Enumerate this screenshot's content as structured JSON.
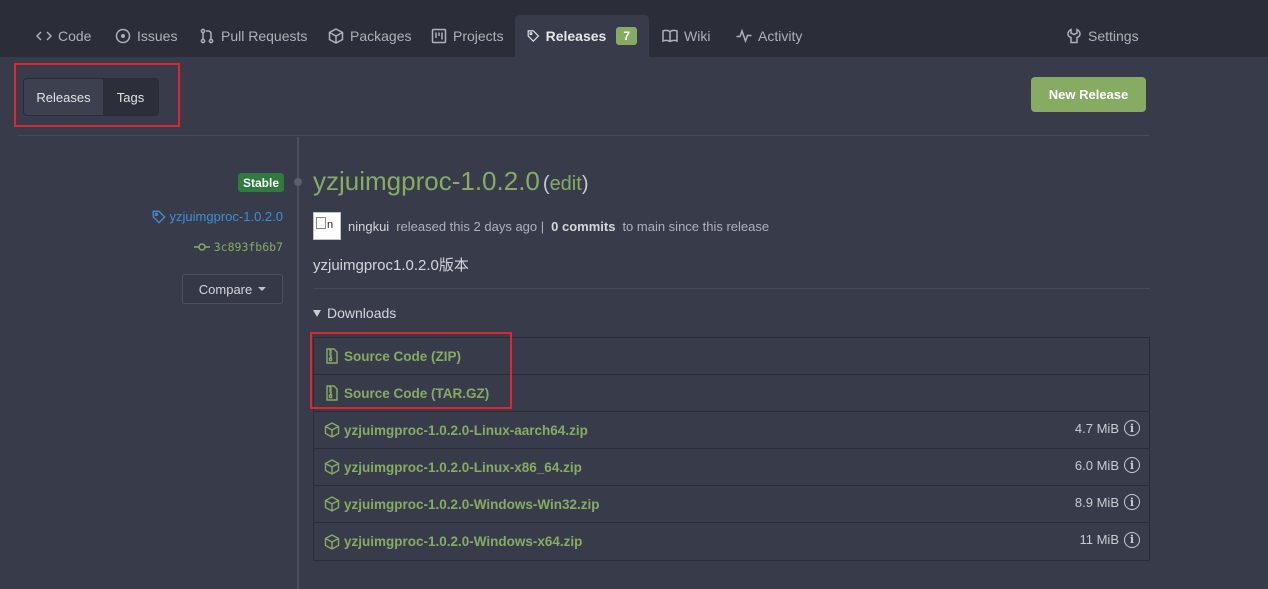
{
  "nav": {
    "tabs": [
      {
        "label": "Code",
        "icon": "code-icon"
      },
      {
        "label": "Issues",
        "icon": "issue-icon"
      },
      {
        "label": "Pull Requests",
        "icon": "pull-request-icon"
      },
      {
        "label": "Packages",
        "icon": "package-icon"
      },
      {
        "label": "Projects",
        "icon": "project-icon"
      },
      {
        "label": "Releases",
        "icon": "tag-icon",
        "count": "7",
        "active": true
      },
      {
        "label": "Wiki",
        "icon": "book-icon"
      },
      {
        "label": "Activity",
        "icon": "pulse-icon"
      }
    ],
    "settings_label": "Settings"
  },
  "toggle": {
    "releases": "Releases",
    "tags": "Tags"
  },
  "new_release_label": "New Release",
  "release": {
    "badge": "Stable",
    "tag": "yzjuimgproc-1.0.2.0",
    "commit": "3c893fb6b7",
    "compare_label": "Compare",
    "title": "yzjuimgproc-1.0.2.0",
    "edit_open": "(",
    "edit_label": "edit",
    "edit_close": ")",
    "avatar_alt": "n",
    "author": "ningkui",
    "released_text": "released this 2 days ago |",
    "commits": "0 commits",
    "commits_suffix": "to main since this release",
    "description": "yzjuimgproc1.0.2.0版本"
  },
  "downloads": {
    "heading": "Downloads",
    "items": [
      {
        "name": "Source Code (ZIP)",
        "icon": "file-zip-icon",
        "size": ""
      },
      {
        "name": "Source Code (TAR.GZ)",
        "icon": "file-zip-icon",
        "size": ""
      },
      {
        "name": "yzjuimgproc-1.0.2.0-Linux-aarch64.zip",
        "icon": "package-icon",
        "size": "4.7 MiB"
      },
      {
        "name": "yzjuimgproc-1.0.2.0-Linux-x86_64.zip",
        "icon": "package-icon",
        "size": "6.0 MiB"
      },
      {
        "name": "yzjuimgproc-1.0.2.0-Windows-Win32.zip",
        "icon": "package-icon",
        "size": "8.9 MiB"
      },
      {
        "name": "yzjuimgproc-1.0.2.0-Windows-x64.zip",
        "icon": "package-icon",
        "size": "11 MiB"
      }
    ]
  },
  "colors": {
    "accent": "#87ab63",
    "link": "#3d8fd7",
    "stable": "#2f7a3f",
    "highlight": "#e0262d"
  }
}
